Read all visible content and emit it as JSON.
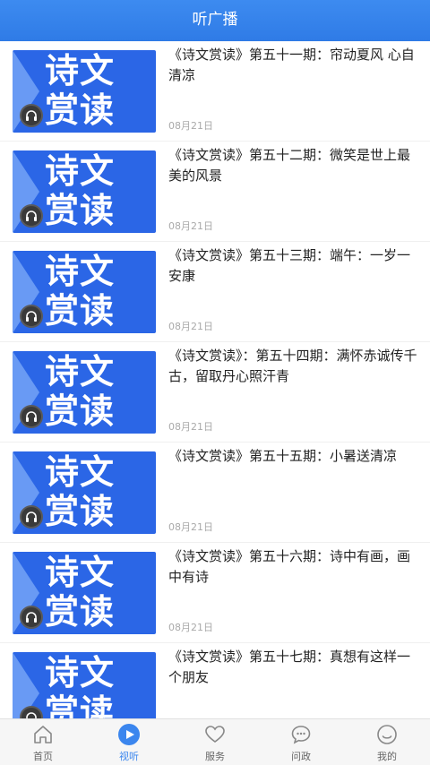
{
  "header": {
    "title": "听广播"
  },
  "thumbnail": {
    "line1": "诗文",
    "line2": "赏读",
    "icon": "headphones-icon"
  },
  "items": [
    {
      "title": "《诗文赏读》第五十一期：帘动夏风 心自清凉",
      "date": "08月21日"
    },
    {
      "title": "《诗文赏读》第五十二期：微笑是世上最美的风景",
      "date": "08月21日"
    },
    {
      "title": "《诗文赏读》第五十三期：端午：一岁一安康",
      "date": "08月21日"
    },
    {
      "title": "《诗文赏读》：第五十四期：满怀赤诚传千古，留取丹心照汗青",
      "date": "08月21日"
    },
    {
      "title": "《诗文赏读》第五十五期：小暑送清凉",
      "date": "08月21日"
    },
    {
      "title": "《诗文赏读》第五十六期：诗中有画，画中有诗",
      "date": "08月21日"
    },
    {
      "title": "《诗文赏读》第五十七期：真想有这样一个朋友",
      "date": ""
    }
  ],
  "tabbar": {
    "tabs": [
      {
        "label": "首页",
        "icon": "home-icon"
      },
      {
        "label": "视听",
        "icon": "play-icon",
        "active": true
      },
      {
        "label": "服务",
        "icon": "heart-icon"
      },
      {
        "label": "问政",
        "icon": "chat-icon"
      },
      {
        "label": "我的",
        "icon": "user-icon"
      }
    ]
  },
  "colors": {
    "header": "#3d8bf0",
    "accent": "#3b86ee",
    "thumb": "#2b66e6"
  }
}
